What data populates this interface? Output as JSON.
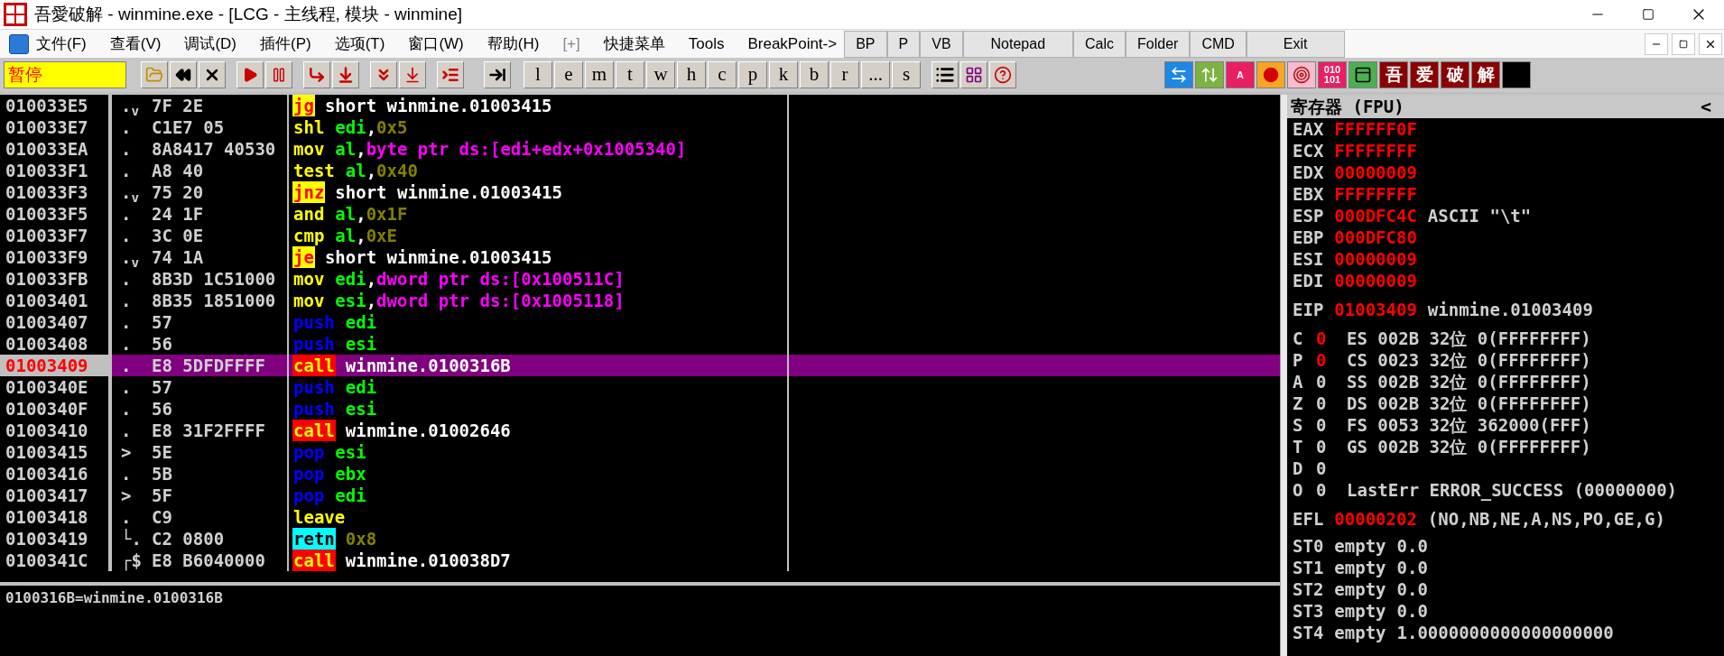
{
  "window": {
    "title": "吾愛破解 - winmine.exe - [LCG -  主线程, 模块 - winmine]"
  },
  "menu": [
    "文件(F)",
    "查看(V)",
    "调试(D)",
    "插件(P)",
    "选项(T)",
    "窗口(W)",
    "帮助(H)",
    "[+]",
    "快捷菜单",
    "Tools",
    "BreakPoint->"
  ],
  "quick_buttons": [
    "BP",
    "P",
    "VB",
    "Notepad",
    "Calc",
    "Folder",
    "CMD",
    "Exit"
  ],
  "toolbar": {
    "status": "暂停",
    "letter_buttons": [
      "l",
      "e",
      "m",
      "t",
      "w",
      "h",
      "c",
      "p",
      "k",
      "b",
      "r",
      "...",
      "s"
    ]
  },
  "plugin_buttons": [
    {
      "kind": "swap"
    },
    {
      "kind": "updown"
    },
    {
      "kind": "letter",
      "label": "A"
    },
    {
      "kind": "dot"
    },
    {
      "kind": "target"
    },
    {
      "kind": "letter",
      "label": "010 101"
    },
    {
      "kind": "panel"
    },
    {
      "kind": "glyph",
      "label": "吾"
    },
    {
      "kind": "glyph",
      "label": "爱"
    },
    {
      "kind": "glyph",
      "label": "破"
    },
    {
      "kind": "glyph",
      "label": "解"
    },
    {
      "kind": "blank"
    }
  ],
  "disassembly": [
    {
      "address": "010033E5",
      "marker": ".$_{v}$",
      "bytes": "7F 2E",
      "mnemonic": "jg",
      "kind": "jump",
      "operands": [
        {
          "text": "short winmine.01003415",
          "kind": "label"
        }
      ],
      "selected": false
    },
    {
      "address": "010033E7",
      "marker": ".",
      "bytes": "C1E7 05",
      "mnemonic": "shl",
      "kind": "plain",
      "operands": [
        {
          "text": "edi",
          "kind": "reg"
        },
        {
          "text": ",",
          "kind": "punct"
        },
        {
          "text": "0x5",
          "kind": "const"
        }
      ],
      "selected": false
    },
    {
      "address": "010033EA",
      "marker": ".",
      "bytes": "8A8417 40530",
      "mnemonic": "mov",
      "kind": "plain",
      "operands": [
        {
          "text": "al",
          "kind": "reg"
        },
        {
          "text": ",",
          "kind": "punct"
        },
        {
          "text": "byte ptr ds:[edi+edx+0x1005340]",
          "kind": "mem"
        }
      ],
      "selected": false
    },
    {
      "address": "010033F1",
      "marker": ".",
      "bytes": "A8 40",
      "mnemonic": "test",
      "kind": "plain",
      "operands": [
        {
          "text": "al",
          "kind": "reg"
        },
        {
          "text": ",",
          "kind": "punct"
        },
        {
          "text": "0x40",
          "kind": "const"
        }
      ],
      "selected": false
    },
    {
      "address": "010033F3",
      "marker": ".$_{v}$",
      "bytes": "75 20",
      "mnemonic": "jnz",
      "kind": "jump",
      "operands": [
        {
          "text": "short winmine.01003415",
          "kind": "label"
        }
      ],
      "selected": false
    },
    {
      "address": "010033F5",
      "marker": ".",
      "bytes": "24 1F",
      "mnemonic": "and",
      "kind": "plain",
      "operands": [
        {
          "text": "al",
          "kind": "reg"
        },
        {
          "text": ",",
          "kind": "punct"
        },
        {
          "text": "0x1F",
          "kind": "const"
        }
      ],
      "selected": false
    },
    {
      "address": "010033F7",
      "marker": ".",
      "bytes": "3C 0E",
      "mnemonic": "cmp",
      "kind": "plain",
      "operands": [
        {
          "text": "al",
          "kind": "reg"
        },
        {
          "text": ",",
          "kind": "punct"
        },
        {
          "text": "0xE",
          "kind": "const"
        }
      ],
      "selected": false
    },
    {
      "address": "010033F9",
      "marker": ".$_{v}$",
      "bytes": "74 1A",
      "mnemonic": "je",
      "kind": "jump",
      "operands": [
        {
          "text": "short winmine.01003415",
          "kind": "label"
        }
      ],
      "selected": false
    },
    {
      "address": "010033FB",
      "marker": ".",
      "bytes": "8B3D 1C51000",
      "mnemonic": "mov",
      "kind": "plain",
      "operands": [
        {
          "text": "edi",
          "kind": "reg"
        },
        {
          "text": ",",
          "kind": "punct"
        },
        {
          "text": "dword ptr ds:[0x100511C]",
          "kind": "mem"
        }
      ],
      "selected": false
    },
    {
      "address": "01003401",
      "marker": ".",
      "bytes": "8B35 1851000",
      "mnemonic": "mov",
      "kind": "plain",
      "operands": [
        {
          "text": "esi",
          "kind": "reg"
        },
        {
          "text": ",",
          "kind": "punct"
        },
        {
          "text": "dword ptr ds:[0x1005118]",
          "kind": "mem"
        }
      ],
      "selected": false
    },
    {
      "address": "01003407",
      "marker": ".",
      "bytes": "57",
      "mnemonic": "push",
      "kind": "stack",
      "operands": [
        {
          "text": "edi",
          "kind": "reg"
        }
      ],
      "selected": false
    },
    {
      "address": "01003408",
      "marker": ".",
      "bytes": "56",
      "mnemonic": "push",
      "kind": "stack",
      "operands": [
        {
          "text": "esi",
          "kind": "reg"
        }
      ],
      "selected": false
    },
    {
      "address": "01003409",
      "marker": ".",
      "bytes": "E8 5DFDFFFF",
      "mnemonic": "call",
      "kind": "call",
      "operands": [
        {
          "text": "winmine.0100316B",
          "kind": "label"
        }
      ],
      "selected": true
    },
    {
      "address": "0100340E",
      "marker": ".",
      "bytes": "57",
      "mnemonic": "push",
      "kind": "stack",
      "operands": [
        {
          "text": "edi",
          "kind": "reg"
        }
      ],
      "selected": false
    },
    {
      "address": "0100340F",
      "marker": ".",
      "bytes": "56",
      "mnemonic": "push",
      "kind": "stack",
      "operands": [
        {
          "text": "esi",
          "kind": "reg"
        }
      ],
      "selected": false
    },
    {
      "address": "01003410",
      "marker": ".",
      "bytes": "E8 31F2FFFF",
      "mnemonic": "call",
      "kind": "call",
      "operands": [
        {
          "text": "winmine.01002646",
          "kind": "label"
        }
      ],
      "selected": false
    },
    {
      "address": "01003415",
      "marker": ">",
      "bytes": "5E",
      "mnemonic": "pop",
      "kind": "stack",
      "operands": [
        {
          "text": "esi",
          "kind": "reg"
        }
      ],
      "selected": false
    },
    {
      "address": "01003416",
      "marker": ".",
      "bytes": "5B",
      "mnemonic": "pop",
      "kind": "stack",
      "operands": [
        {
          "text": "ebx",
          "kind": "reg"
        }
      ],
      "selected": false
    },
    {
      "address": "01003417",
      "marker": ">",
      "bytes": "5F",
      "mnemonic": "pop",
      "kind": "stack",
      "operands": [
        {
          "text": "edi",
          "kind": "reg"
        }
      ],
      "selected": false
    },
    {
      "address": "01003418",
      "marker": ".",
      "bytes": "C9",
      "mnemonic": "leave",
      "kind": "plain",
      "selected": false
    },
    {
      "address": "01003419",
      "marker": "└.",
      "bytes": "C2 0800",
      "mnemonic": "retn",
      "kind": "ret",
      "operands": [
        {
          "text": "0x8",
          "kind": "const"
        }
      ],
      "selected": false
    },
    {
      "address": "0100341C",
      "marker": "┌$",
      "bytes": "E8 B6040000",
      "mnemonic": "call",
      "kind": "call",
      "operands": [
        {
          "text": "winmine.010038D7",
          "kind": "label"
        }
      ],
      "selected": false
    }
  ],
  "info_line": "0100316B=winmine.0100316B",
  "registers_panel": {
    "title": "寄存器 (FPU)",
    "collapse": "<",
    "registers": [
      {
        "name": "EAX",
        "value": "FFFFFF0F",
        "changed": true
      },
      {
        "name": "ECX",
        "value": "FFFFFFFF",
        "changed": true
      },
      {
        "name": "EDX",
        "value": "00000009",
        "changed": true
      },
      {
        "name": "EBX",
        "value": "FFFFFFFF",
        "changed": true
      },
      {
        "name": "ESP",
        "value": "000DFC4C",
        "changed": true,
        "note": "ASCII \"\\t\""
      },
      {
        "name": "EBP",
        "value": "000DFC80",
        "changed": true
      },
      {
        "name": "ESI",
        "value": "00000009",
        "changed": true
      },
      {
        "name": "EDI",
        "value": "00000009",
        "changed": true
      }
    ],
    "eip": {
      "name": "EIP",
      "value": "01003409",
      "changed": true,
      "note": "winmine.01003409"
    },
    "flags": [
      {
        "name": "C",
        "value": "0",
        "changed": true,
        "detail": "ES 002B 32位 0(FFFFFFFF)"
      },
      {
        "name": "P",
        "value": "0",
        "changed": true,
        "detail": "CS 0023 32位 0(FFFFFFFF)"
      },
      {
        "name": "A",
        "value": "0",
        "changed": false,
        "detail": "SS 002B 32位 0(FFFFFFFF)"
      },
      {
        "name": "Z",
        "value": "0",
        "changed": false,
        "detail": "DS 002B 32位 0(FFFFFFFF)"
      },
      {
        "name": "S",
        "value": "0",
        "changed": false,
        "detail": "FS 0053 32位 362000(FFF)"
      },
      {
        "name": "T",
        "value": "0",
        "changed": false,
        "detail": "GS 002B 32位 0(FFFFFFFF)"
      },
      {
        "name": "D",
        "value": "0",
        "changed": false
      },
      {
        "name": "O",
        "value": "0",
        "changed": false,
        "detail": "LastErr ERROR_SUCCESS (00000000)"
      }
    ],
    "efl": {
      "name": "EFL",
      "value": "00000202",
      "changed": true,
      "note": "(NO,NB,NE,A,NS,PO,GE,G)"
    },
    "fpu": [
      {
        "name": "ST0",
        "state": "empty",
        "value": "0.0"
      },
      {
        "name": "ST1",
        "state": "empty",
        "value": "0.0"
      },
      {
        "name": "ST2",
        "state": "empty",
        "value": "0.0"
      },
      {
        "name": "ST3",
        "state": "empty",
        "value": "0.0"
      },
      {
        "name": "ST4",
        "state": "empty",
        "value": "1.0000000000000000000"
      }
    ]
  }
}
